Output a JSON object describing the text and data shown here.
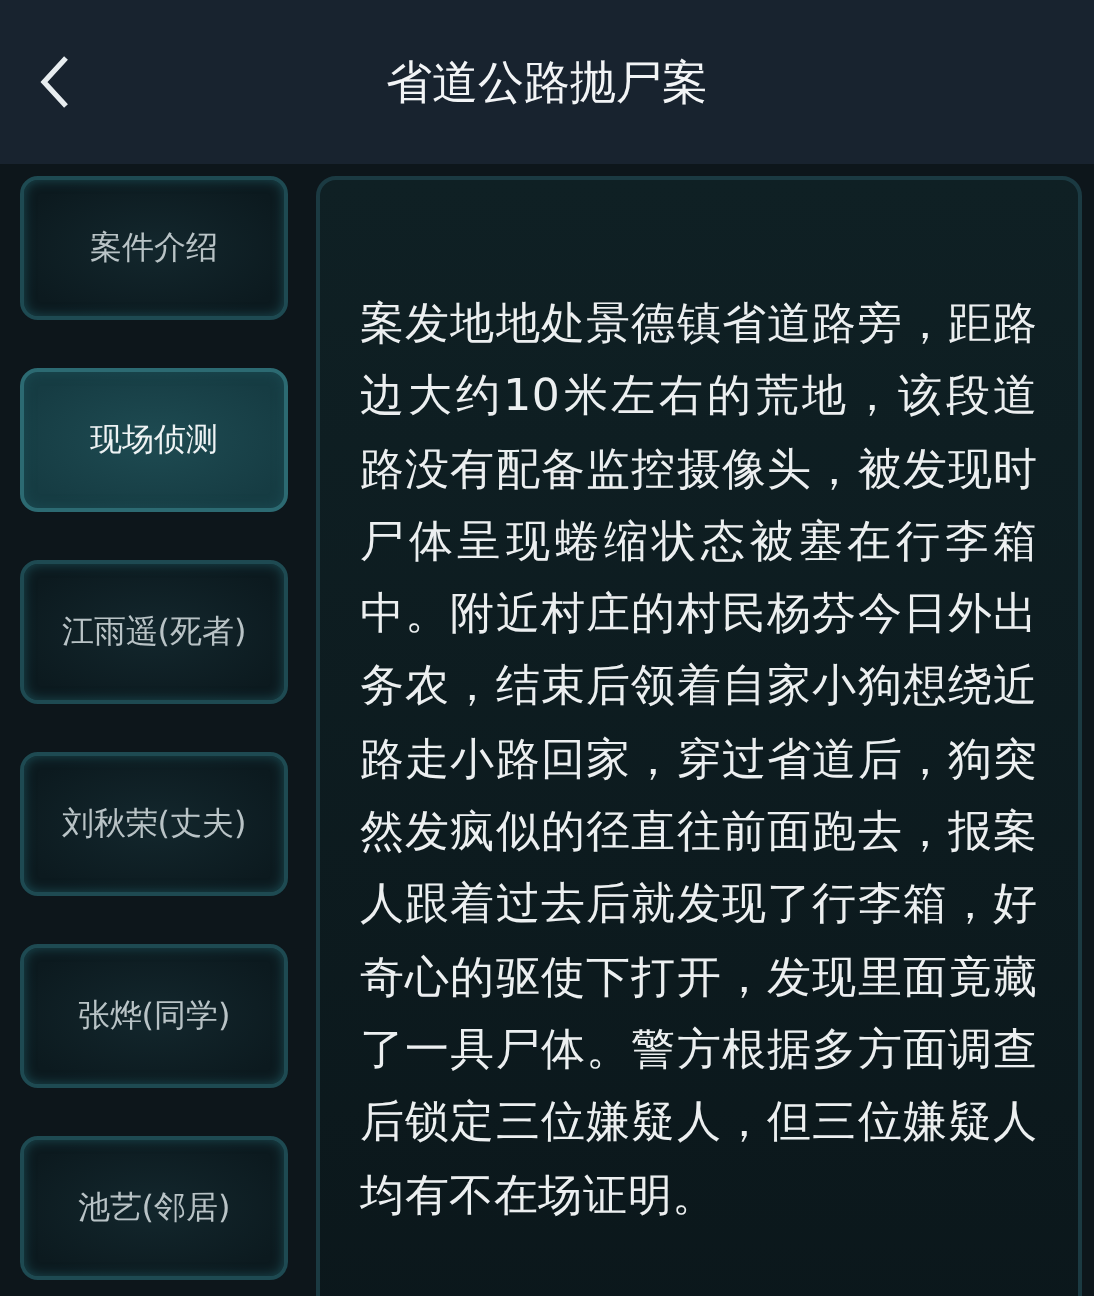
{
  "header": {
    "title": "省道公路抛尸案"
  },
  "tabs": [
    {
      "label": "案件介绍",
      "selected": false
    },
    {
      "label": "现场侦测",
      "selected": true
    },
    {
      "label": "江雨遥(死者)",
      "selected": false
    },
    {
      "label": "刘秋荣(丈夫)",
      "selected": false
    },
    {
      "label": "张烨(同学)",
      "selected": false
    },
    {
      "label": "池艺(邻居)",
      "selected": false
    }
  ],
  "content": {
    "text": "案发地地处景德镇省道路旁，距路边大约10米左右的荒地，该段道路没有配备监控摄像头，被发现时尸体呈现蜷缩状态被塞在行李箱中。附近村庄的村民杨芬今日外出务农，结束后领着自家小狗想绕近路走小路回家，穿过省道后，狗突然发疯似的径直往前面跑去，报案人跟着过去后就发现了行李箱，好奇心的驱使下打开，发现里面竟藏了一具尸体。警方根据多方面调查后锁定三位嫌疑人，但三位嫌疑人均有不在场证明。"
  }
}
